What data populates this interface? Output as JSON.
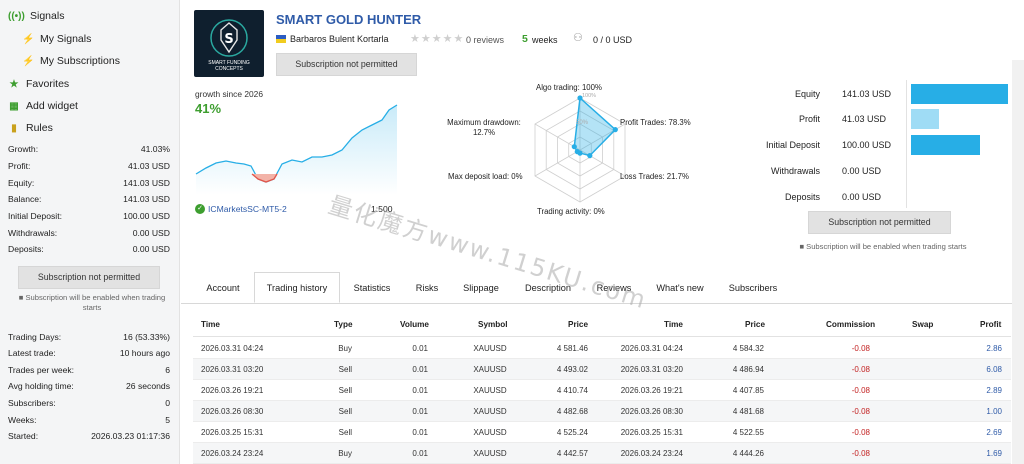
{
  "sidebar": {
    "nav": {
      "signals": "Signals",
      "my_signals": "My Signals",
      "my_subscriptions": "My Subscriptions",
      "favorites": "Favorites",
      "add_widget": "Add widget",
      "rules": "Rules"
    },
    "stats": [
      {
        "label": "Growth:",
        "value": "41.03%"
      },
      {
        "label": "Profit:",
        "value": "41.03 USD"
      },
      {
        "label": "Equity:",
        "value": "141.03 USD"
      },
      {
        "label": "Balance:",
        "value": "141.03 USD"
      },
      {
        "label": "Initial Deposit:",
        "value": "100.00 USD"
      },
      {
        "label": "Withdrawals:",
        "value": "0.00 USD"
      },
      {
        "label": "Deposits:",
        "value": "0.00 USD"
      }
    ],
    "subscribe_button": "Subscription not permitted",
    "subscribe_note": "Subscription will be enabled when trading starts",
    "info": [
      {
        "label": "Trading Days:",
        "value": "16 (53.33%)"
      },
      {
        "label": "Latest trade:",
        "value": "10 hours ago"
      },
      {
        "label": "Trades per week:",
        "value": "6"
      },
      {
        "label": "Avg holding time:",
        "value": "26 seconds"
      },
      {
        "label": "Subscribers:",
        "value": "0"
      },
      {
        "label": "Weeks:",
        "value": "5"
      },
      {
        "label": "Started:",
        "value": "2026.03.23 01:17:36"
      }
    ]
  },
  "signal": {
    "logo_text": "SMART FUNDING CONCEPTS",
    "name": "SMART GOLD HUNTER",
    "author": "Barbaros Bulent Kortarla",
    "reviews": "0 reviews",
    "weeks_count": "5",
    "weeks_label": "weeks",
    "subscribers": "0 / 0 USD",
    "subscribe_button": "Subscription not permitted",
    "rating_stars": 0
  },
  "growth": {
    "label": "growth since 2026",
    "value": "41%",
    "broker": "ICMarketsSC-MT5-2",
    "leverage": "1:500"
  },
  "radar": {
    "labels": {
      "algo": "Algo trading: 100%",
      "profit": "Profit Trades: 78.3%",
      "loss": "Loss Trades: 21.7%",
      "activity": "Trading activity: 0%",
      "load": "Max deposit load: 0%",
      "drawdown_title": "Maximum drawdown:",
      "drawdown_value": "12.7%"
    },
    "ticks": {
      "t100": "100%",
      "t50": "50%"
    },
    "values": {
      "algo": 100,
      "profit": 78.3,
      "loss": 21.7,
      "activity": 0,
      "load": 0,
      "drawdown": 12.7
    }
  },
  "metrics": {
    "rows": [
      {
        "label": "Equity",
        "value": "141.03 USD",
        "amount": 141.03
      },
      {
        "label": "Profit",
        "value": "41.03 USD",
        "amount": 41.03
      },
      {
        "label": "Initial Deposit",
        "value": "100.00 USD",
        "amount": 100.0
      },
      {
        "label": "Withdrawals",
        "value": "0.00 USD",
        "amount": 0
      },
      {
        "label": "Deposits",
        "value": "0.00 USD",
        "amount": 0
      }
    ],
    "subscribe_button": "Subscription not permitted",
    "note": "Subscription will be enabled when trading starts"
  },
  "tabs": [
    "Account",
    "Trading history",
    "Statistics",
    "Risks",
    "Slippage",
    "Description",
    "Reviews",
    "What's new",
    "Subscribers"
  ],
  "table": {
    "headers": [
      "Time",
      "Type",
      "Volume",
      "Symbol",
      "Price",
      "Time",
      "Price",
      "Commission",
      "Swap",
      "Profit"
    ],
    "rows": [
      [
        "2026.03.31 04:24",
        "Buy",
        "0.01",
        "XAUUSD",
        "4 581.46",
        "2026.03.31 04:24",
        "4 584.32",
        "-0.08",
        "",
        "2.86"
      ],
      [
        "2026.03.31 03:20",
        "Sell",
        "0.01",
        "XAUUSD",
        "4 493.02",
        "2026.03.31 03:20",
        "4 486.94",
        "-0.08",
        "",
        "6.08"
      ],
      [
        "2026.03.26 19:21",
        "Sell",
        "0.01",
        "XAUUSD",
        "4 410.74",
        "2026.03.26 19:21",
        "4 407.85",
        "-0.08",
        "",
        "2.89"
      ],
      [
        "2026.03.26 08:30",
        "Sell",
        "0.01",
        "XAUUSD",
        "4 482.68",
        "2026.03.26 08:30",
        "4 481.68",
        "-0.08",
        "",
        "1.00"
      ],
      [
        "2026.03.25 15:31",
        "Sell",
        "0.01",
        "XAUUSD",
        "4 525.24",
        "2026.03.25 15:31",
        "4 522.55",
        "-0.08",
        "",
        "2.69"
      ],
      [
        "2026.03.24 23:24",
        "Buy",
        "0.01",
        "XAUUSD",
        "4 442.57",
        "2026.03.24 23:24",
        "4 444.26",
        "-0.08",
        "",
        "1.69"
      ]
    ]
  },
  "watermark": "量化魔方www.115KU.com",
  "colors": {
    "accent": "#2f5ba8",
    "green": "#3d9e2f",
    "bar": "#27aee6",
    "bar_light": "#9fdcf5",
    "negative": "#c32222"
  }
}
